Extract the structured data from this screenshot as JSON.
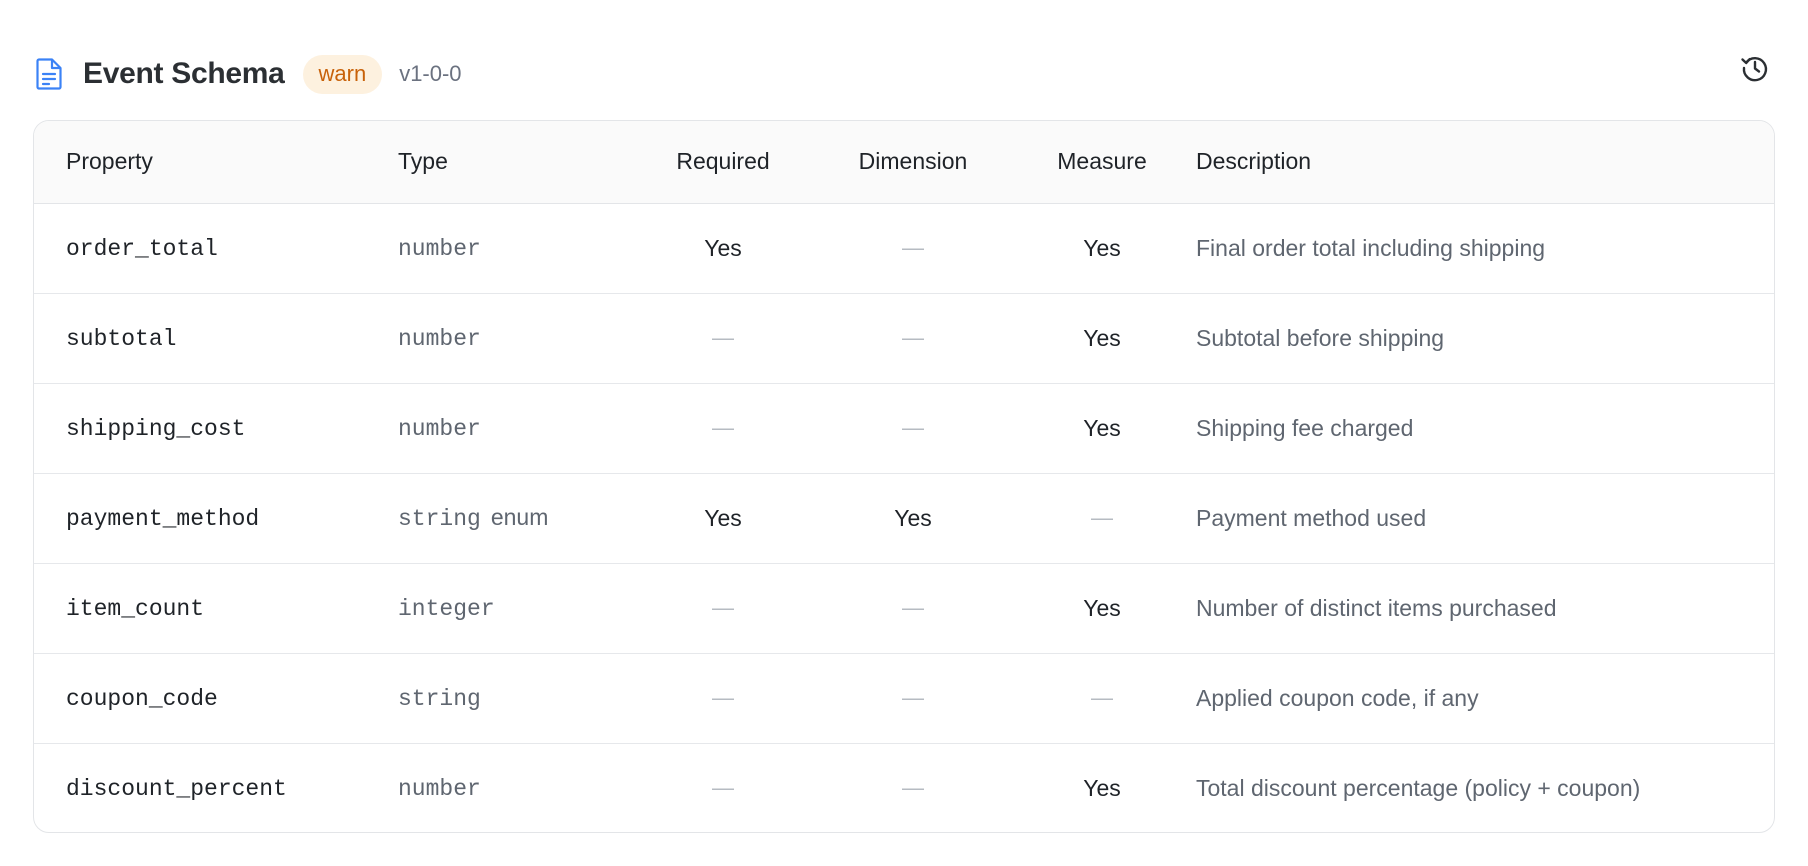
{
  "header": {
    "title": "Event Schema",
    "badge": "warn",
    "version": "v1-0-0",
    "icon": "document-icon",
    "history_icon": "history-icon",
    "accent_color": "#3b82f6",
    "badge_color": "#c8620a",
    "badge_bg": "#fdf1df"
  },
  "table": {
    "columns": [
      "Property",
      "Type",
      "Required",
      "Dimension",
      "Measure",
      "Description"
    ],
    "rows": [
      {
        "property": "order_total",
        "type": "number",
        "enum": "",
        "required": "Yes",
        "dimension": "—",
        "measure": "Yes",
        "description": "Final order total including shipping"
      },
      {
        "property": "subtotal",
        "type": "number",
        "enum": "",
        "required": "—",
        "dimension": "—",
        "measure": "Yes",
        "description": "Subtotal before shipping"
      },
      {
        "property": "shipping_cost",
        "type": "number",
        "enum": "",
        "required": "—",
        "dimension": "—",
        "measure": "Yes",
        "description": "Shipping fee charged"
      },
      {
        "property": "payment_method",
        "type": "string",
        "enum": "enum",
        "required": "Yes",
        "dimension": "Yes",
        "measure": "—",
        "description": "Payment method used"
      },
      {
        "property": "item_count",
        "type": "integer",
        "enum": "",
        "required": "—",
        "dimension": "—",
        "measure": "Yes",
        "description": "Number of distinct items purchased"
      },
      {
        "property": "coupon_code",
        "type": "string",
        "enum": "",
        "required": "—",
        "dimension": "—",
        "measure": "—",
        "description": "Applied coupon code, if any"
      },
      {
        "property": "discount_percent",
        "type": "number",
        "enum": "",
        "required": "—",
        "dimension": "—",
        "measure": "Yes",
        "description": "Total discount percentage (policy + coupon)"
      }
    ]
  }
}
